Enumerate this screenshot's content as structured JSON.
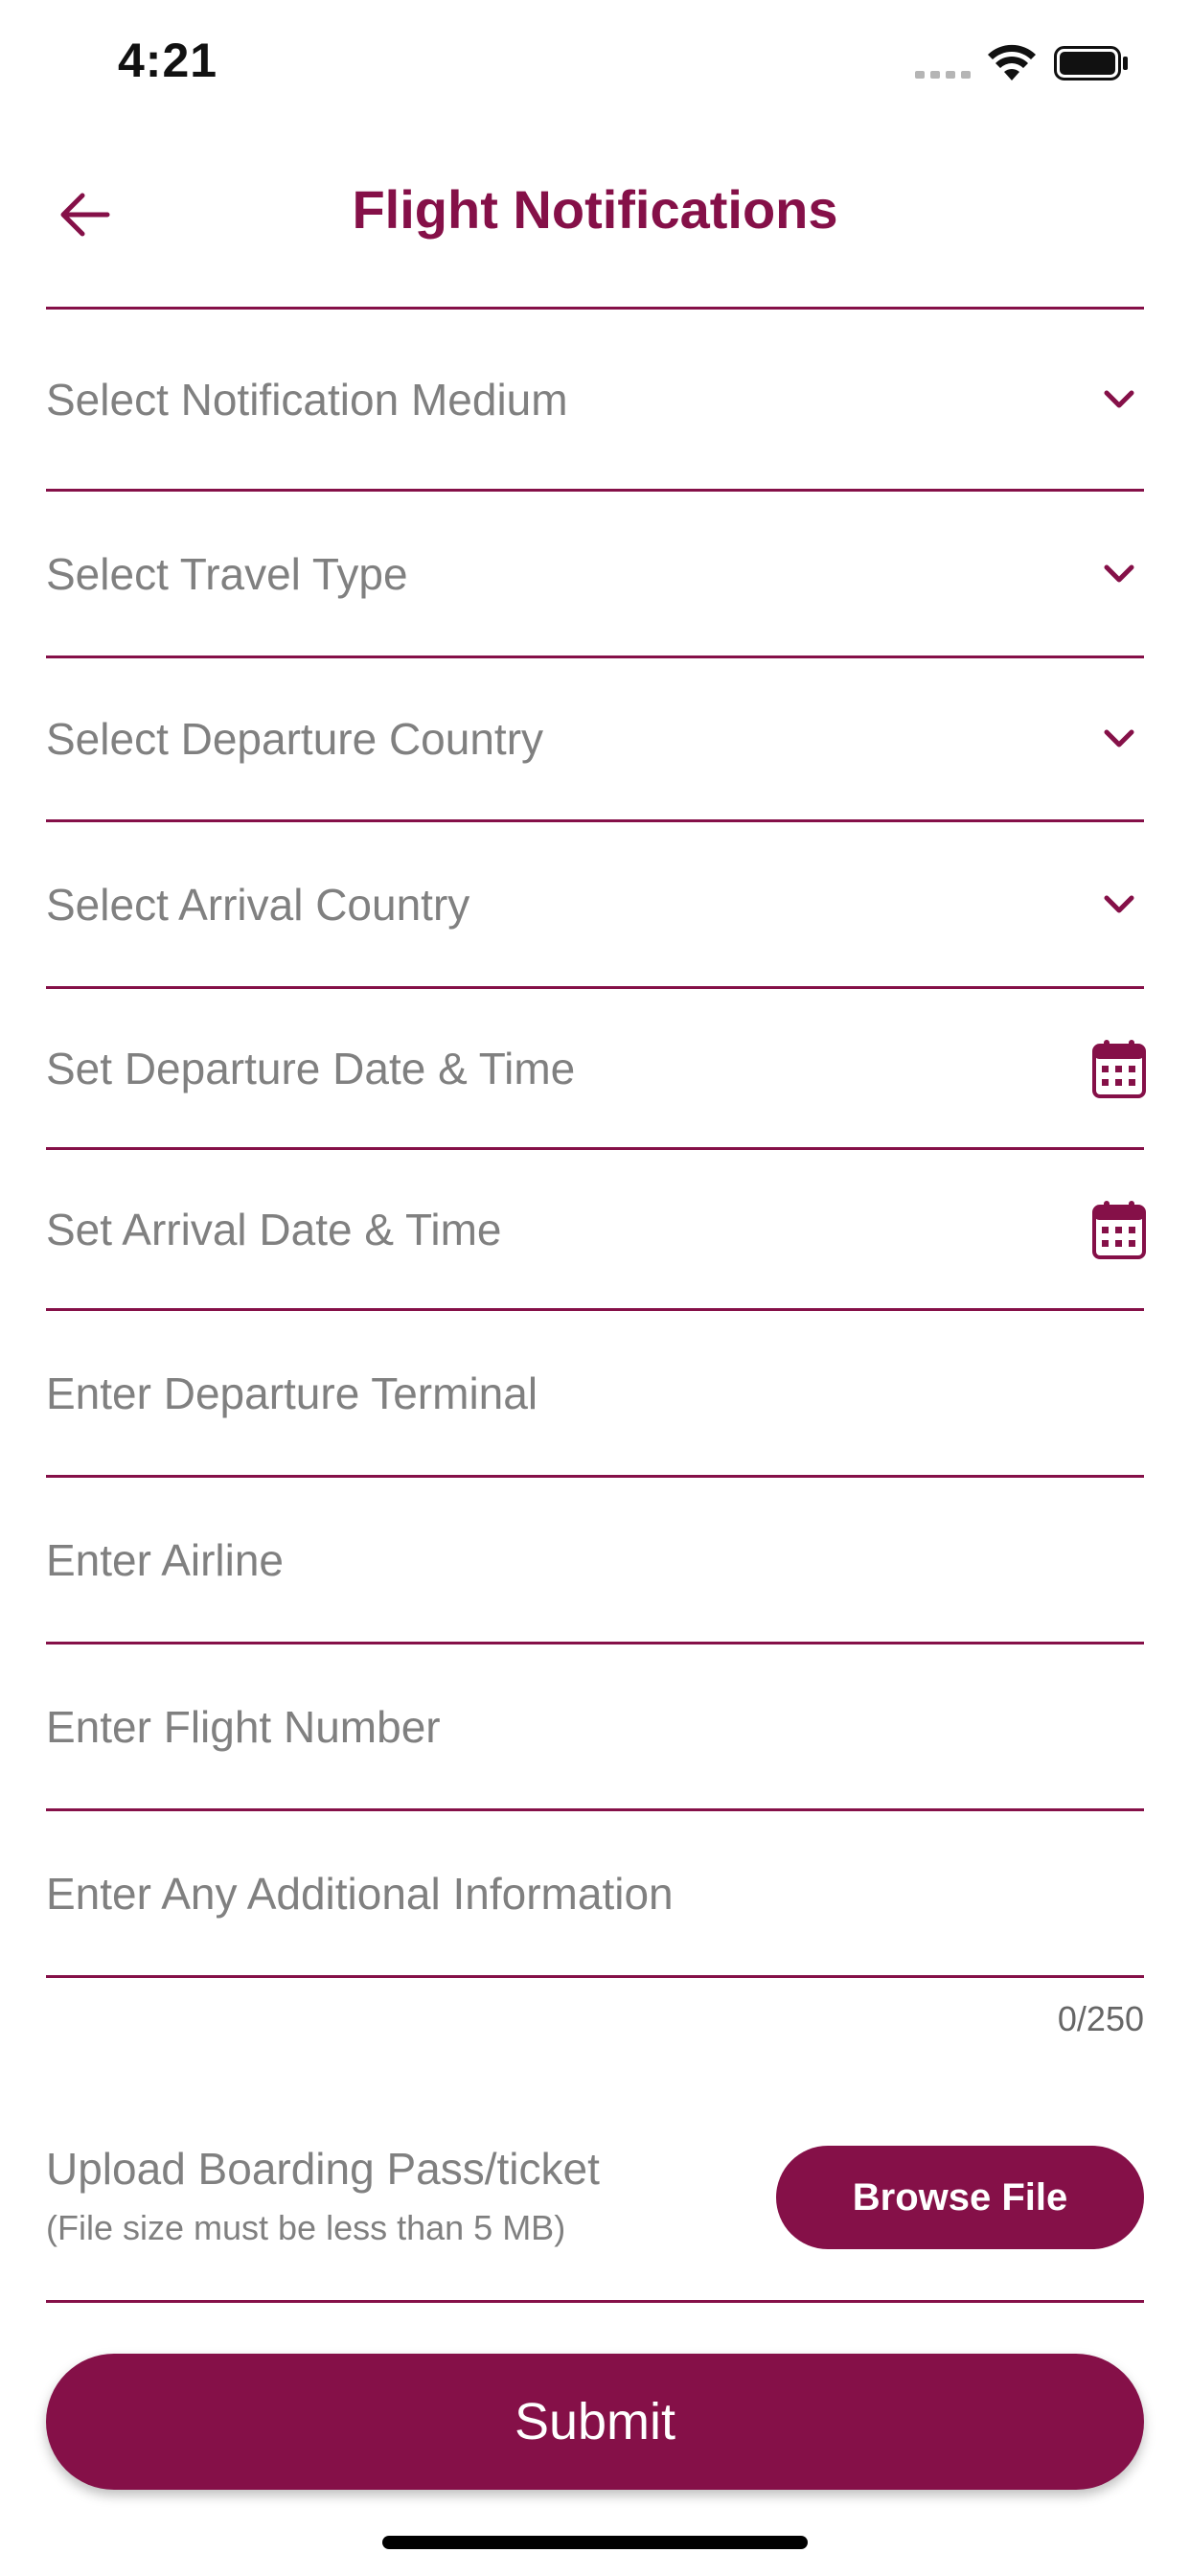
{
  "status_bar": {
    "time": "4:21"
  },
  "header": {
    "title": "Flight Notifications",
    "back_icon": "arrow-left-icon"
  },
  "form": {
    "fields": [
      {
        "label": "Select Notification Medium",
        "icon": "chevron-down-icon"
      },
      {
        "label": "Select Travel Type",
        "icon": "chevron-down-icon"
      },
      {
        "label": "Select Departure Country",
        "icon": "chevron-down-icon"
      },
      {
        "label": "Select Arrival Country",
        "icon": "chevron-down-icon"
      },
      {
        "label": "Set Departure Date & Time",
        "icon": "calendar-icon"
      },
      {
        "label": "Set Arrival Date & Time",
        "icon": "calendar-icon"
      },
      {
        "label": "Enter Departure Terminal"
      },
      {
        "label": "Enter Airline"
      },
      {
        "label": "Enter Flight Number"
      },
      {
        "label": "Enter Any Additional Information"
      }
    ],
    "char_counter": "0/250",
    "upload": {
      "label": "Upload Boarding Pass/ticket",
      "hint": "(File size must be less than 5 MB)",
      "button_label": "Browse File"
    },
    "submit_label": "Submit"
  },
  "colors": {
    "accent": "#851048",
    "placeholder": "#808080"
  }
}
